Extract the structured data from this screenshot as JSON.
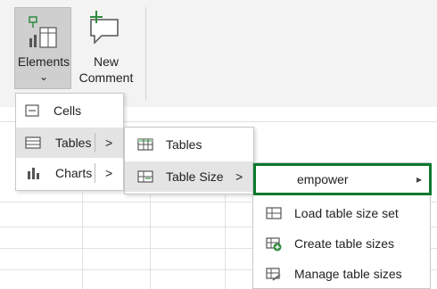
{
  "ribbon": {
    "elements_label": "Elements",
    "elements_chevron": "⌄",
    "comment_label_line1": "New",
    "comment_label_line2": "Comment"
  },
  "menu1": {
    "items": [
      {
        "label": "Cells"
      },
      {
        "label": "Tables",
        "arrow": ">"
      },
      {
        "label": "Charts",
        "arrow": ">"
      }
    ]
  },
  "menu2": {
    "items": [
      {
        "label": "Tables"
      },
      {
        "label": "Table Size",
        "arrow": ">"
      }
    ]
  },
  "menu3": {
    "items": [
      {
        "label": "empower",
        "arrow": "▸"
      },
      {
        "label": "Load table size set"
      },
      {
        "label": "Create table sizes"
      },
      {
        "label": "Manage table sizes"
      }
    ]
  },
  "colors": {
    "highlight_border": "#0a7a2e",
    "icon_green": "#2e8b3e"
  }
}
